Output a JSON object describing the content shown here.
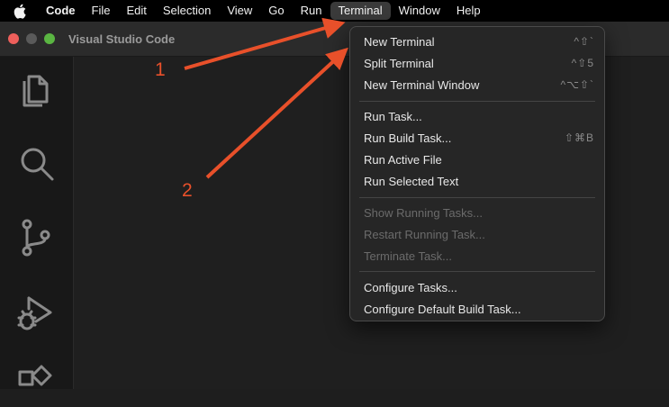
{
  "menubar": {
    "apple_icon": "apple-icon",
    "items": [
      "Code",
      "File",
      "Edit",
      "Selection",
      "View",
      "Go",
      "Run",
      "Terminal",
      "Window",
      "Help"
    ]
  },
  "window": {
    "title": "Visual Studio Code"
  },
  "activitybar": {
    "icons": [
      "files-icon",
      "search-icon",
      "source-control-icon",
      "run-debug-icon",
      "extensions-icon"
    ]
  },
  "terminal_menu": {
    "new_terminal": {
      "label": "New Terminal",
      "shortcut": "^⇧`"
    },
    "split_terminal": {
      "label": "Split Terminal",
      "shortcut": "^⇧5"
    },
    "new_terminal_window": {
      "label": "New Terminal Window",
      "shortcut": "^⌥⇧`"
    },
    "run_task": {
      "label": "Run Task..."
    },
    "run_build_task": {
      "label": "Run Build Task...",
      "shortcut": "⇧⌘B"
    },
    "run_active_file": {
      "label": "Run Active File"
    },
    "run_selected_text": {
      "label": "Run Selected Text"
    },
    "show_running_tasks": {
      "label": "Show Running Tasks..."
    },
    "restart_running_task": {
      "label": "Restart Running Task..."
    },
    "terminate_task": {
      "label": "Terminate Task..."
    },
    "configure_tasks": {
      "label": "Configure Tasks..."
    },
    "configure_default_build_task": {
      "label": "Configure Default Build Task..."
    }
  },
  "annotations": {
    "label_1": "1",
    "label_2": "2",
    "color": "#e8502a"
  },
  "colors": {
    "menubar_bg": "#000000",
    "menu_bg": "#262626",
    "accent_red": "#ee5f5b",
    "accent_green": "#5ab542"
  }
}
